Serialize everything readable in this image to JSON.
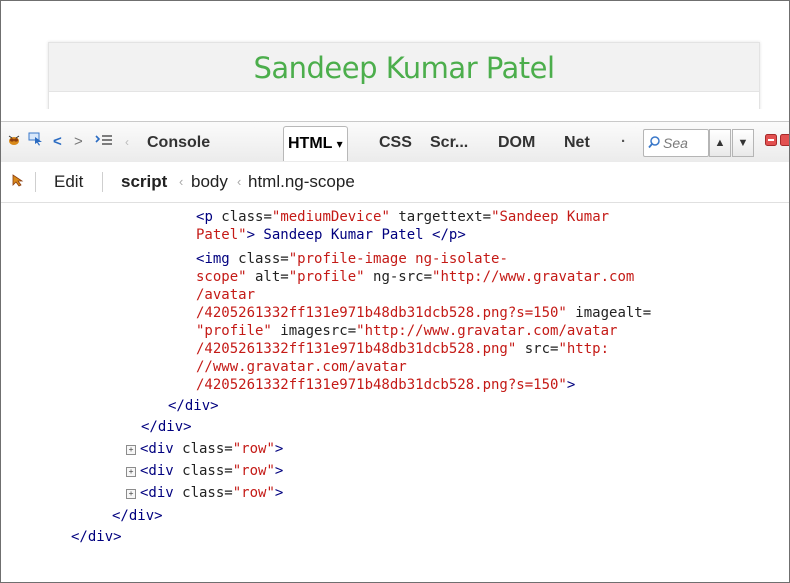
{
  "page": {
    "title": "Sandeep Kumar Patel"
  },
  "toolbar": {
    "tabs": [
      {
        "label": "Console"
      },
      {
        "label": "HTML"
      },
      {
        "label": "CSS"
      },
      {
        "label": "Scr..."
      },
      {
        "label": "DOM"
      },
      {
        "label": "Net"
      }
    ],
    "html_dropdown": "▾",
    "more_glyph": "·",
    "search_placeholder": "Sea",
    "prev_arrow": "▲",
    "next_arrow": "▼"
  },
  "breadcrumb": {
    "edit_label": "Edit",
    "items": [
      "script",
      "body",
      "html.ng-scope"
    ]
  },
  "code_lines": [
    [
      "<",
      "p",
      " class=",
      "\"mediumDevice\"",
      " targettext=",
      "\"Sandeep Kumar"
    ],
    [
      "Patel\"",
      "> Sandeep Kumar Patel </",
      "p",
      ">"
    ],
    [
      "<",
      "img",
      " class=",
      "\"profile-image ng-isolate-"
    ],
    [
      "scope\"",
      " alt=",
      "\"profile\"",
      " ng-src=",
      "\"http://www.gravatar.com"
    ],
    [
      "/avatar"
    ],
    [
      "/4205261332ff131e971b48db31dcb528.png?s=150\"",
      " imagealt="
    ],
    [
      "\"profile\"",
      " imagesrc=",
      "\"http://www.gravatar.com/avatar"
    ],
    [
      "/4205261332ff131e971b48db31dcb528.png\"",
      " src=",
      "\"http:"
    ],
    [
      "//www.gravatar.com/avatar"
    ],
    [
      "/4205261332ff131e971b48db31dcb528.png?s=150\"",
      ">"
    ],
    [
      "</div>"
    ],
    [
      "</div>"
    ],
    [
      "<div",
      " class=",
      "\"row\"",
      ">"
    ],
    [
      "<div",
      " class=",
      "\"row\"",
      ">"
    ],
    [
      "<div",
      " class=",
      "\"row\"",
      ">"
    ],
    [
      "</div>"
    ],
    [
      "</div>"
    ]
  ],
  "colors": {
    "title_green": "#4cae4c",
    "tag_blue": "#00007f",
    "value_red": "#c41a16"
  }
}
